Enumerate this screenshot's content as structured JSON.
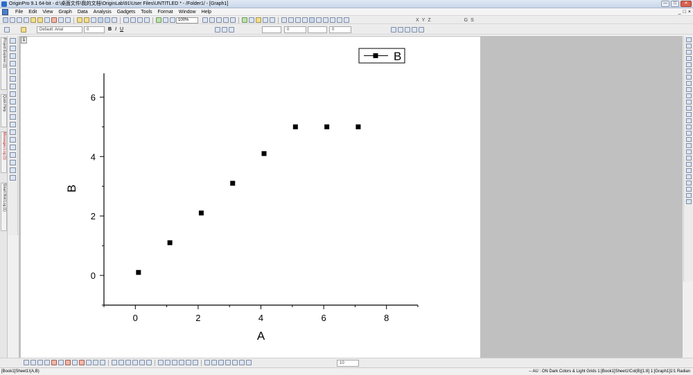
{
  "window": {
    "title": "OriginPro 9.1 64-bit - d:\\桌面文件\\我的文档\\OriginLab\\91\\User Files\\UNTITLED * - /Folder1/ - [Graph1]",
    "controls": [
      "—",
      "□",
      "✕"
    ]
  },
  "menu": {
    "items": [
      "File",
      "Edit",
      "View",
      "Graph",
      "Data",
      "Analysis",
      "Gadgets",
      "Tools",
      "Format",
      "Window",
      "Help"
    ],
    "mdi_controls": [
      "_",
      "□",
      "×"
    ]
  },
  "toolbar": {
    "zoom_value": "100%",
    "right_letters": [
      "X",
      "Y",
      "Z",
      "G",
      "S"
    ]
  },
  "format_toolbar": {
    "font_name": "Default: Arial",
    "font_size": "0",
    "bold": "B",
    "italic": "I",
    "underline": "U",
    "line_width": "0",
    "line_size": "0"
  },
  "side_tabs": {
    "project_explorer": "Project Explorer (1)",
    "quick_help": "Quick Help",
    "messages_log": "Messages Log (1)",
    "smart_hint_log": "Smart Hint Log (1)"
  },
  "graph": {
    "layer_label": "1"
  },
  "chart_data": {
    "type": "scatter",
    "series": [
      {
        "name": "B",
        "x": [
          0.1,
          1.1,
          2.1,
          3.1,
          4.1,
          5.1,
          6.1,
          7.1
        ],
        "y": [
          0.1,
          1.1,
          2.1,
          3.1,
          4.1,
          5.0,
          5.0,
          5.0
        ]
      }
    ],
    "xlabel": "A",
    "ylabel": "B",
    "xlim": [
      -1,
      9
    ],
    "ylim": [
      -1,
      6.8
    ],
    "xticks": [
      0,
      2,
      4,
      6,
      8
    ],
    "yticks": [
      0,
      2,
      4,
      6
    ],
    "marker": "square",
    "marker_color": "#000000",
    "legend_position": "top-right",
    "grid": false
  },
  "bottom_toolbar": {
    "size_value": "10"
  },
  "status": {
    "left": "[Book1]Sheet1!(A,B)",
    "right": "-- AU : ON  Dark Colors & Light Grids  1:[Book1]Sheet1!Col(B)[1:8]  1:[Graph1]1!1  Radian"
  }
}
